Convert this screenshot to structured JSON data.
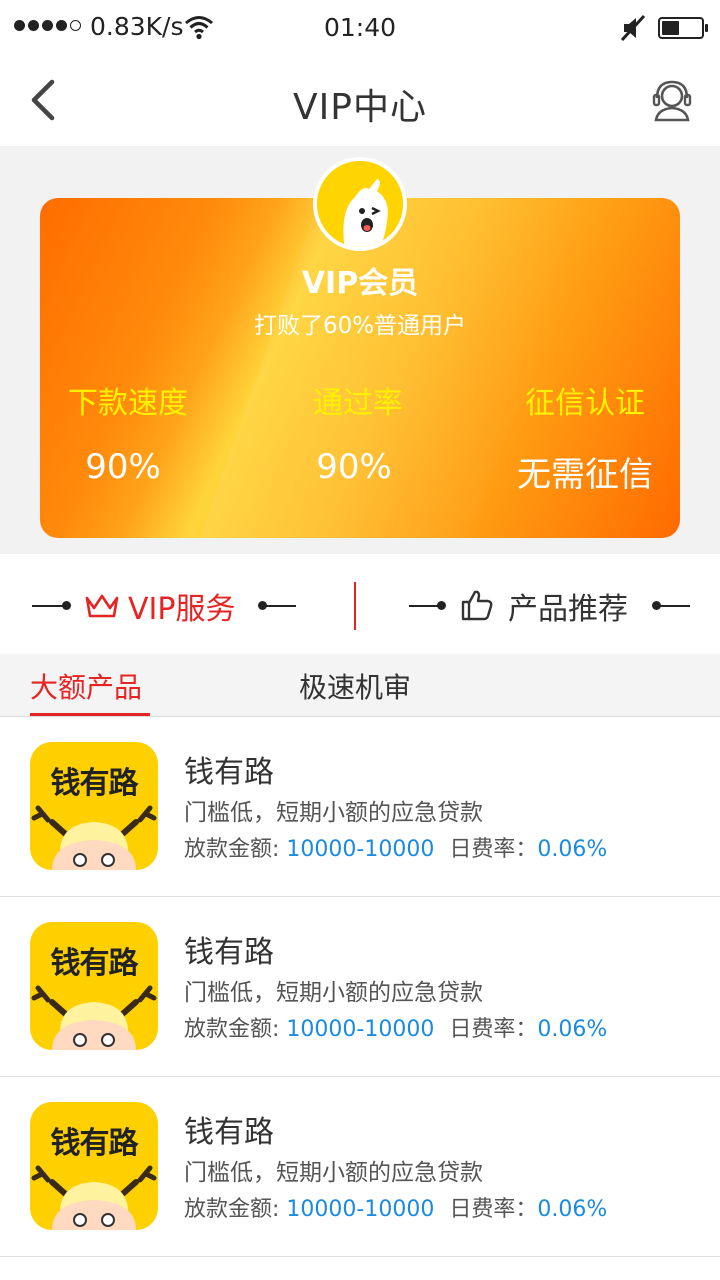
{
  "status_bar": {
    "network_speed": "0.83K/s",
    "time": "01:40",
    "signal_icon": "signal-dots-icon",
    "wifi_icon": "wifi-icon",
    "mute_icon": "mute-icon",
    "battery_icon": "battery-icon",
    "battery_level": 0.45
  },
  "nav": {
    "title": "VIP中心",
    "back_icon": "chevron-left-icon",
    "service_icon": "customer-service-icon"
  },
  "vip_card": {
    "level": "VIP会员",
    "description": "打败了60%普通用户",
    "stats": [
      {
        "label": "下款速度",
        "value": "90%"
      },
      {
        "label": "通过率",
        "value": "90%"
      },
      {
        "label": "征信认证",
        "value": "无需征信"
      }
    ],
    "colors": {
      "start": "#ff6d00",
      "mid": "#ffd43b",
      "label": "#fff200"
    }
  },
  "section_switch": {
    "vip_service": "VIP服务",
    "product_recommend": "产品推荐",
    "crown_icon": "crown-icon",
    "thumbs_up_icon": "thumbs-up-icon"
  },
  "tabs": [
    {
      "label": "大额产品",
      "active": true
    },
    {
      "label": "极速机审",
      "active": false
    }
  ],
  "products": [
    {
      "logo_text": "钱有路",
      "name": "钱有路",
      "desc": "门槛低，短期小额的应急贷款",
      "amount_label": "放款金额:",
      "amount": "10000-10000",
      "rate_label": "日费率：",
      "rate": "0.06%"
    },
    {
      "logo_text": "钱有路",
      "name": "钱有路",
      "desc": "门槛低，短期小额的应急贷款",
      "amount_label": "放款金额:",
      "amount": "10000-10000",
      "rate_label": "日费率：",
      "rate": "0.06%"
    },
    {
      "logo_text": "钱有路",
      "name": "钱有路",
      "desc": "门槛低，短期小额的应急贷款",
      "amount_label": "放款金额:",
      "amount": "10000-10000",
      "rate_label": "日费率：",
      "rate": "0.06%"
    }
  ],
  "accent_colors": {
    "red": "#e52424",
    "blue": "#1b8be0",
    "brand_yellow": "#ffd000"
  }
}
